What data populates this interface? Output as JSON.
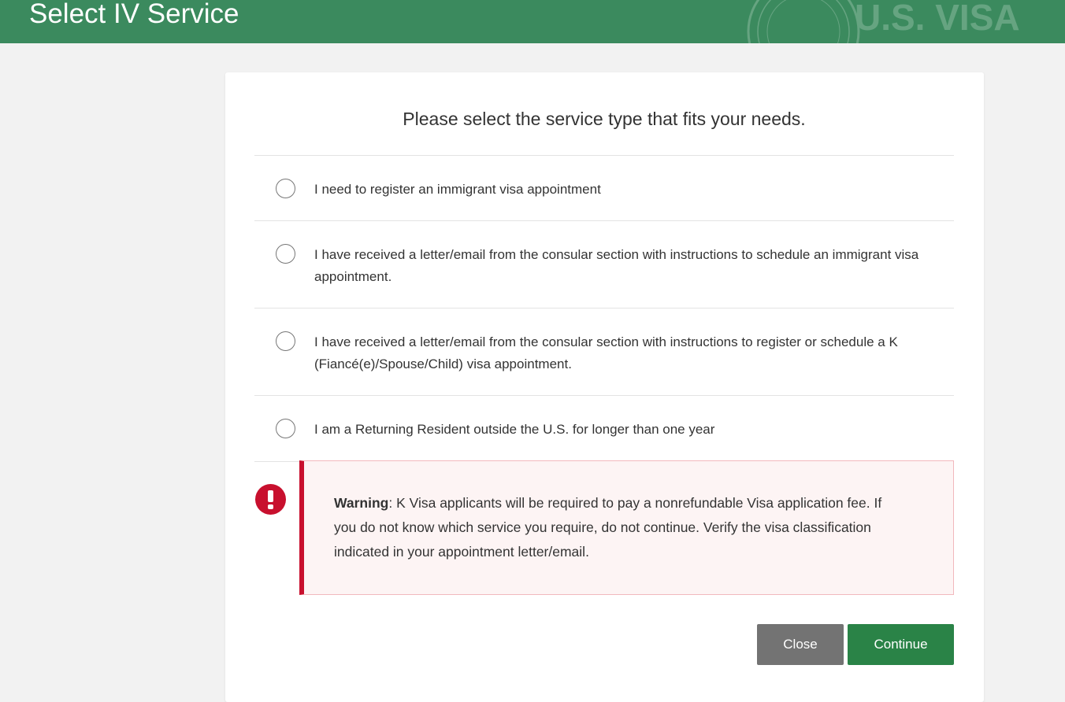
{
  "header": {
    "title": "Select IV Service",
    "watermark_text": "U.S. VISA"
  },
  "prompt": "Please select the service type that fits your needs.",
  "options": [
    {
      "label": "I need to register an immigrant visa appointment",
      "selected": false
    },
    {
      "label": "I have received a letter/email from the consular section with instructions to schedule an immigrant visa appointment.",
      "selected": false
    },
    {
      "label": "I have received a letter/email from the consular section with instructions to register or schedule a K (Fiancé(e)/Spouse/Child) visa appointment.",
      "selected": false
    },
    {
      "label": "I am a Returning Resident outside the U.S. for longer than one year",
      "selected": false
    }
  ],
  "warning": {
    "icon": "exclamation-circle-icon",
    "label": "Warning",
    "text": ": K Visa applicants will be required to pay a nonrefundable Visa application fee. If you do not know which service you require, do not continue. Verify the visa classification indicated in your appointment letter/email."
  },
  "buttons": {
    "close": "Close",
    "continue": "Continue"
  },
  "colors": {
    "header": "#3b8a5e",
    "warning_accent": "#c8102e",
    "continue": "#2a8347",
    "close": "#737373"
  }
}
